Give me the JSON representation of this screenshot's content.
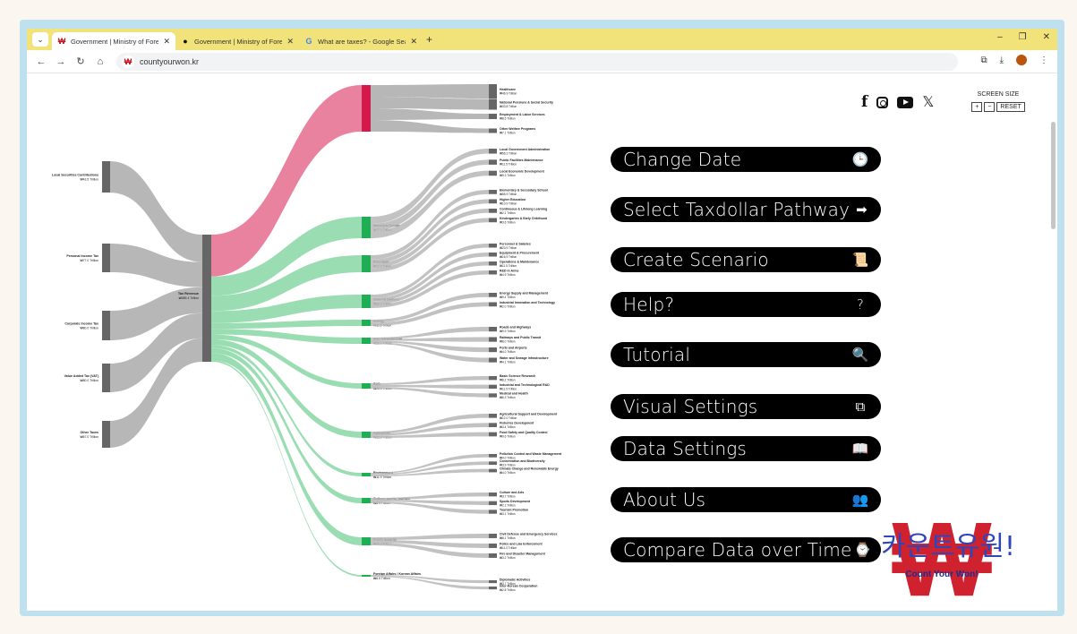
{
  "browser": {
    "tabs": [
      {
        "favicon": "won-favicon",
        "title": "Government | Ministry of Fore..",
        "active": true
      },
      {
        "favicon": "chrome-favicon",
        "title": "Government | Ministry of Fore..",
        "active": false
      },
      {
        "favicon": "google-favicon",
        "title": "What are taxes? - Google Sear..",
        "active": false
      }
    ],
    "url": "countyourwon.kr"
  },
  "sankey": {
    "sources": [
      {
        "label": "Local Securities Contributions",
        "amount": "₩43.5 Trillion"
      },
      {
        "label": "Personal Income Tax",
        "amount": "₩77.0 Trillion"
      },
      {
        "label": "Corporate Income Tax",
        "amount": "₩80.0 Trillion"
      },
      {
        "label": "Value Added Tax (VAT)",
        "amount": "₩80.0 Trillion"
      },
      {
        "label": "Other Taxes",
        "amount": "₩67.0 Trillion"
      }
    ],
    "center": {
      "label": "Tax Revenue",
      "amount": "₩389.4 Trillion"
    },
    "categories": [
      {
        "label": "Health and Social Welfare",
        "amount": "₩96.3 Trillion",
        "color": "#d41a4c"
      },
      {
        "label": "Municipal Grants",
        "amount": "₩77.0 Trillion",
        "color": "#1fae54"
      },
      {
        "label": "Education",
        "amount": "₩72.5 Trillion",
        "color": "#1fae54"
      },
      {
        "label": "National Defence",
        "amount": "₩59.6 Trillion",
        "color": "#1fae54"
      },
      {
        "label": "Energy",
        "amount": "₩11.5 Trillion",
        "color": "#1fae54"
      },
      {
        "label": "SOC Infrastructure",
        "amount": "₩26.1 Trillion",
        "color": "#1fae54"
      },
      {
        "label": "R&D",
        "amount": "₩26.0 Trillion",
        "color": "#1fae54"
      },
      {
        "label": "Agriculture",
        "amount": "₩25.0 Trillion",
        "color": "#1fae54"
      },
      {
        "label": "Environment",
        "amount": "₩11.9 Trillion",
        "color": "#1fae54"
      },
      {
        "label": "Culture, sports, tourism",
        "amount": "₩8.9 Trillion",
        "color": "#1fae54"
      },
      {
        "label": "Public Security",
        "amount": "₩22.3 Trillion",
        "color": "#1fae54"
      },
      {
        "label": "Foreign Affairs / Korean Affairs",
        "amount": "₩6.5 Trillion",
        "color": "#1fae54"
      }
    ],
    "leaves": [
      {
        "label": "Healthcare",
        "amount": "₩46.9 Trillion"
      },
      {
        "label": "National Pensions & Social Security",
        "amount": "₩33.8 Trillion"
      },
      {
        "label": "Employment & Labor Services",
        "amount": "₩8.5 Trillion"
      },
      {
        "label": "Other Welfare Programs",
        "amount": "₩7.1 Trillion"
      },
      {
        "label": "Local Government Administration",
        "amount": "₩56.2 Trillion"
      },
      {
        "label": "Public Facilities Maintenance",
        "amount": "₩11.5 Trillion"
      },
      {
        "label": "Local Economic Development",
        "amount": "₩9.3 Trillion"
      },
      {
        "label": "Elementary & Secondary School",
        "amount": "₩55.9 Trillion"
      },
      {
        "label": "Higher Education",
        "amount": "₩10.9 Trillion"
      },
      {
        "label": "Continuous & Lifelong Learning",
        "amount": "₩2.1 Trillion"
      },
      {
        "label": "Kindergarten & Early Childhood",
        "amount": "₩3.6 Trillion"
      },
      {
        "label": "Personnel & Salaries",
        "amount": "₩23.9 Trillion"
      },
      {
        "label": "Equipment & Procurement",
        "amount": "₩16.9 Trillion"
      },
      {
        "label": "Operations & Maintenance",
        "amount": "₩11.5 Trillion"
      },
      {
        "label": "R&D in Arms",
        "amount": "₩4.9 Trillion"
      },
      {
        "label": "Energy Supply and Management",
        "amount": "₩9.4 Trillion"
      },
      {
        "label": "Industrial Innovation and Technology",
        "amount": "₩2.0 Trillion"
      },
      {
        "label": "Roads and Highways",
        "amount": "₩9.9 Trillion"
      },
      {
        "label": "Railways and Public Transit",
        "amount": "₩8.0 Trillion"
      },
      {
        "label": "Ports and Airports",
        "amount": "₩4.0 Trillion"
      },
      {
        "label": "Water and Sewage Infrastructure",
        "amount": "₩4.1 Trillion"
      },
      {
        "label": "Basic Science Research",
        "amount": "₩8.2 Trillion"
      },
      {
        "label": "Industrial and Technological R&D",
        "amount": "₩11.5 Trillion"
      },
      {
        "label": "Medical and Health",
        "amount": "₩6.3 Trillion"
      },
      {
        "label": "Agricultural Support and Development",
        "amount": "₩12.0 Trillion"
      },
      {
        "label": "Fisheries Development",
        "amount": "₩3.4 Trillion"
      },
      {
        "label": "Food Safety and Quality Control",
        "amount": "₩9.6 Trillion"
      },
      {
        "label": "Pollution Control and Waste Management",
        "amount": "₩4.0 Trillion"
      },
      {
        "label": "Conservation and Biodiversity",
        "amount": "₩3.9 Trillion"
      },
      {
        "label": "Climate Change and Renewable Energy",
        "amount": "₩4.0 Trillion"
      },
      {
        "label": "Culture and Arts",
        "amount": "₩3.7 Trillion"
      },
      {
        "label": "Sports Development",
        "amount": "₩2.1 Trillion"
      },
      {
        "label": "Tourism Promotion",
        "amount": "₩3.1 Trillion"
      },
      {
        "label": "Civil Defense and Emergency Services",
        "amount": "₩8.1 Trillion"
      },
      {
        "label": "Police and Law Enforcement",
        "amount": "₩11.0 Trillion"
      },
      {
        "label": "Fire and Disaster Management",
        "amount": "₩3.2 Trillion"
      },
      {
        "label": "Diplomatic Activities",
        "amount": "₩3.7 Trillion"
      },
      {
        "label": "Inter-Korean Cooperation",
        "amount": "₩2.8 Trillion"
      }
    ]
  },
  "social": {
    "facebook": "f",
    "x": "𝕏"
  },
  "screen_size": {
    "title": "SCREEN SIZE",
    "plus": "+",
    "minus": "−",
    "reset": "RESET"
  },
  "menu": [
    {
      "label": "Change Date",
      "icon": "clock-icon",
      "glyph": "🕒"
    },
    {
      "label": "Select Taxdollar Pathway",
      "icon": "arrow-right-icon",
      "glyph": "➡"
    },
    {
      "label": "Create Scenario",
      "icon": "scroll-pen-icon",
      "glyph": "📜"
    },
    {
      "label": "Help?",
      "icon": "question-icon",
      "glyph": "?"
    },
    {
      "label": "Tutorial",
      "icon": "search-icon",
      "glyph": "🔍"
    },
    {
      "label": "Visual Settings",
      "icon": "windows-icon",
      "glyph": "⧉"
    },
    {
      "label": "Data Settings",
      "icon": "book-icon",
      "glyph": "📖"
    },
    {
      "label": "About Us",
      "icon": "people-icon",
      "glyph": "👥"
    },
    {
      "label": "Compare Data over Time",
      "icon": "clocks-icon",
      "glyph": "⌚"
    }
  ],
  "logo": {
    "korean": "카운트유원!",
    "english": "Count Your Won!",
    "symbol": "₩"
  },
  "colors": {
    "welfare": "#d41a4c",
    "welfare_flow": "#e8829f",
    "spend": "#1fae54",
    "spend_flow": "#8fd9aa",
    "neutral": "#b7b7b7",
    "node": "#666666"
  }
}
